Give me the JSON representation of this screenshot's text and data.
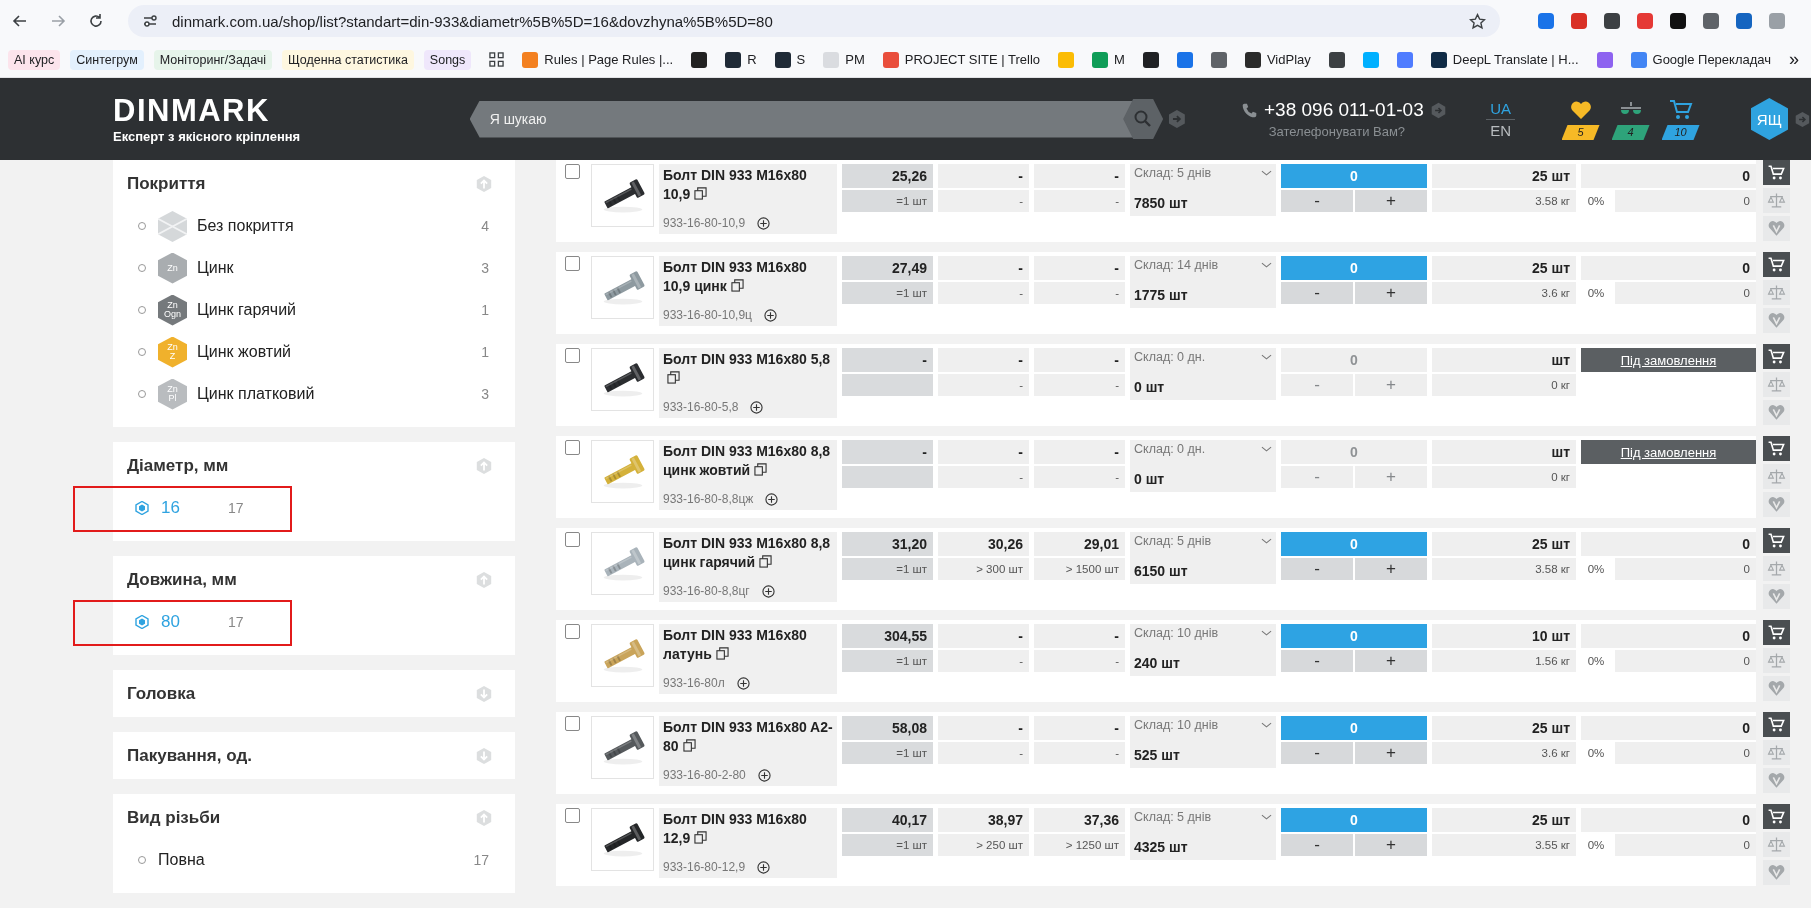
{
  "browser": {
    "url": "dinmark.com.ua/shop/list?standart=din-933&diametr%5B%5D=16&dovzhyna%5B%5D=80",
    "extensions": [
      {
        "color": "#1a73e8"
      },
      {
        "color": "#d93025"
      },
      {
        "color": "#3c4043"
      },
      {
        "color": "#e53935"
      },
      {
        "color": "#111111"
      },
      {
        "color": "#5f6368"
      },
      {
        "color": "#1565c0"
      },
      {
        "color": "#9aa0a6"
      }
    ],
    "bookmarks": [
      {
        "kind": "chip",
        "label": "AI курс",
        "color": "#fce4ec"
      },
      {
        "kind": "chip",
        "label": "Синтегрум",
        "color": "#e3f0fd"
      },
      {
        "kind": "chip",
        "label": "Моніторинг/Задачі",
        "color": "#e6f4ea"
      },
      {
        "kind": "chip",
        "label": "Щоденна статистика",
        "color": "#fef7e0"
      },
      {
        "kind": "chip",
        "label": "Songs",
        "color": "#efe7fb"
      },
      {
        "kind": "apps"
      },
      {
        "kind": "site",
        "label": "Rules | Page Rules |...",
        "color": "#f38020"
      },
      {
        "kind": "site",
        "color": "#222222"
      },
      {
        "kind": "site",
        "label": "R",
        "color": "#1f2a36"
      },
      {
        "kind": "site",
        "label": "S",
        "color": "#1f2a36"
      },
      {
        "kind": "site",
        "label": "PM",
        "color": "#dadce0"
      },
      {
        "kind": "site",
        "label": "PROJECT SITE | Trello",
        "color": "#e94e3c"
      },
      {
        "kind": "site",
        "color": "#fbbc04"
      },
      {
        "kind": "site",
        "label": "M",
        "color": "#0f9d58"
      },
      {
        "kind": "site",
        "color": "#202124"
      },
      {
        "kind": "site",
        "color": "#1a73e8"
      },
      {
        "kind": "site",
        "color": "#5f6368"
      },
      {
        "kind": "site",
        "label": "VidPlay",
        "color": "#2b2b2b"
      },
      {
        "kind": "site",
        "color": "#3c4043"
      },
      {
        "kind": "site",
        "color": "#00b0ff"
      },
      {
        "kind": "site",
        "color": "#4f7cff"
      },
      {
        "kind": "site",
        "label": "DeepL Translate | H...",
        "color": "#0f2b46"
      },
      {
        "kind": "site",
        "color": "#8e63f0"
      },
      {
        "kind": "site",
        "label": "Google Перекладач",
        "color": "#4285f4"
      },
      {
        "kind": "more",
        "label": "»"
      }
    ]
  },
  "header": {
    "logo": "DINMARK",
    "tagline": "Експерт з якісного кріплення",
    "search": {
      "placeholder": "Я шукаю"
    },
    "phone": "+38 096 011-01-03",
    "callback": "Зателефонувати Вам?",
    "languages": [
      {
        "label": "UA",
        "selected": true
      },
      {
        "label": "EN",
        "selected": false
      }
    ],
    "counters": [
      {
        "kind": "favorites",
        "count": "5",
        "color": "#f6b926"
      },
      {
        "kind": "compare",
        "count": "4",
        "color": "#2ea37a"
      },
      {
        "kind": "cart",
        "count": "10",
        "color": "#2fa3e0"
      }
    ],
    "user": "ЯЩ"
  },
  "filters": [
    {
      "title": "Покриття",
      "expanded": true,
      "options": [
        {
          "label": "Без покриття",
          "count": "4",
          "selected": false,
          "badge": {
            "kind": "cross",
            "color": "#d5d8da"
          }
        },
        {
          "label": "Цинк",
          "count": "3",
          "selected": false,
          "badge": {
            "kind": "text",
            "lines": [
              "Zn"
            ],
            "color": "#a9adb0"
          }
        },
        {
          "label": "Цинк гарячий",
          "count": "1",
          "selected": false,
          "badge": {
            "kind": "text",
            "lines": [
              "Zn",
              "Ogn"
            ],
            "color": "#75797c"
          }
        },
        {
          "label": "Цинк жовтий",
          "count": "1",
          "selected": false,
          "badge": {
            "kind": "text",
            "lines": [
              "Zn",
              "Z"
            ],
            "color": "#f0b12c"
          }
        },
        {
          "label": "Цинк платковий",
          "count": "3",
          "selected": false,
          "badge": {
            "kind": "text",
            "lines": [
              "Zn",
              "Pl"
            ],
            "color": "#b9bcbf"
          }
        }
      ]
    },
    {
      "title": "Діаметр, мм",
      "expanded": true,
      "options": [
        {
          "label": "16",
          "count": "17",
          "selected": true,
          "highlighted": true
        }
      ]
    },
    {
      "title": "Довжина, мм",
      "expanded": true,
      "options": [
        {
          "label": "80",
          "count": "17",
          "selected": true,
          "highlighted": true
        }
      ]
    },
    {
      "title": "Головка",
      "expanded": false
    },
    {
      "title": "Пакування, од.",
      "expanded": false
    },
    {
      "title": "Вид різьби",
      "expanded": true,
      "options": [
        {
          "label": "Повна",
          "count": "17",
          "selected": false
        }
      ]
    }
  ],
  "products": [
    {
      "name": "Болт DIN 933 M16x80 10,9",
      "code": "933-16-80-10,9",
      "checked": false,
      "prices": [
        {
          "price": "25,26",
          "min": "=1 шт"
        },
        {
          "price": "-",
          "min": "-"
        },
        {
          "price": "-",
          "min": "-"
        }
      ],
      "stock_label": "Склад: 5 днів",
      "stock": "7850 шт",
      "quantity": "0",
      "available": true,
      "minus": "-",
      "plus": "+",
      "pack": "25 шт",
      "weight": "3.58 кг",
      "total": "0",
      "discount": "0%",
      "sum": "0"
    },
    {
      "name": "Болт DIN 933 M16x80 10,9 цинк",
      "code": "933-16-80-10,9ц",
      "checked": false,
      "prices": [
        {
          "price": "27,49",
          "min": "=1 шт"
        },
        {
          "price": "-",
          "min": "-"
        },
        {
          "price": "-",
          "min": "-"
        }
      ],
      "stock_label": "Склад: 14 днів",
      "stock": "1775 шт",
      "quantity": "0",
      "available": true,
      "minus": "-",
      "plus": "+",
      "pack": "25 шт",
      "weight": "3.6 кг",
      "total": "0",
      "discount": "0%",
      "sum": "0"
    },
    {
      "name": "Болт DIN 933 M16x80 5,8",
      "code": "933-16-80-5,8",
      "checked": false,
      "prices": [
        {
          "price": "-"
        },
        {
          "price": "-",
          "min": "-"
        },
        {
          "price": "-",
          "min": "-"
        }
      ],
      "stock_label": "Склад: 0 дн.",
      "stock": "0 шт",
      "quantity": "0",
      "available": false,
      "minus": "-",
      "plus": "+",
      "pack": "шт",
      "weight": "0 кг",
      "order_button": "Під замовлення"
    },
    {
      "name": "Болт DIN 933 M16x80 8,8 цинк жовтий",
      "code": "933-16-80-8,8цж",
      "checked": false,
      "prices": [
        {
          "price": "-"
        },
        {
          "price": "-",
          "min": "-"
        },
        {
          "price": "-",
          "min": "-"
        }
      ],
      "stock_label": "Склад: 0 дн.",
      "stock": "0 шт",
      "quantity": "0",
      "available": false,
      "minus": "-",
      "plus": "+",
      "pack": "шт",
      "weight": "0 кг",
      "order_button": "Під замовлення"
    },
    {
      "name": "Болт DIN 933 M16x80 8,8 цинк гарячий",
      "code": "933-16-80-8,8цг",
      "checked": false,
      "prices": [
        {
          "price": "31,20",
          "min": "=1 шт"
        },
        {
          "price": "30,26",
          "min": "> 300 шт"
        },
        {
          "price": "29,01",
          "min": "> 1500 шт"
        }
      ],
      "stock_label": "Склад: 5 днів",
      "stock": "6150 шт",
      "quantity": "0",
      "available": true,
      "minus": "-",
      "plus": "+",
      "pack": "25 шт",
      "weight": "3.58 кг",
      "total": "0",
      "discount": "0%",
      "sum": "0"
    },
    {
      "name": "Болт DIN 933 M16x80 латунь",
      "code": "933-16-80л",
      "checked": false,
      "prices": [
        {
          "price": "304,55",
          "min": "=1 шт"
        },
        {
          "price": "-",
          "min": "-"
        },
        {
          "price": "-",
          "min": "-"
        }
      ],
      "stock_label": "Склад: 10 днів",
      "stock": "240 шт",
      "quantity": "0",
      "available": true,
      "minus": "-",
      "plus": "+",
      "pack": "10 шт",
      "weight": "1.56 кг",
      "total": "0",
      "discount": "0%",
      "sum": "0"
    },
    {
      "name": "Болт DIN 933 M16x80 A2-80",
      "code": "933-16-80-2-80",
      "checked": false,
      "prices": [
        {
          "price": "58,08",
          "min": "=1 шт"
        },
        {
          "price": "-",
          "min": "-"
        },
        {
          "price": "-",
          "min": "-"
        }
      ],
      "stock_label": "Склад: 10 днів",
      "stock": "525 шт",
      "quantity": "0",
      "available": true,
      "minus": "-",
      "plus": "+",
      "pack": "25 шт",
      "weight": "3.6 кг",
      "total": "0",
      "discount": "0%",
      "sum": "0"
    },
    {
      "name": "Болт DIN 933 M16x80 12,9",
      "code": "933-16-80-12,9",
      "checked": false,
      "prices": [
        {
          "price": "40,17",
          "min": "=1 шт"
        },
        {
          "price": "38,97",
          "min": "> 250 шт"
        },
        {
          "price": "37,36",
          "min": "> 1250 шт"
        }
      ],
      "stock_label": "Склад: 5 днів",
      "stock": "4325 шт",
      "quantity": "0",
      "available": true,
      "minus": "-",
      "plus": "+",
      "pack": "25 шт",
      "weight": "3.55 кг",
      "total": "0",
      "discount": "0%",
      "sum": "0"
    }
  ]
}
